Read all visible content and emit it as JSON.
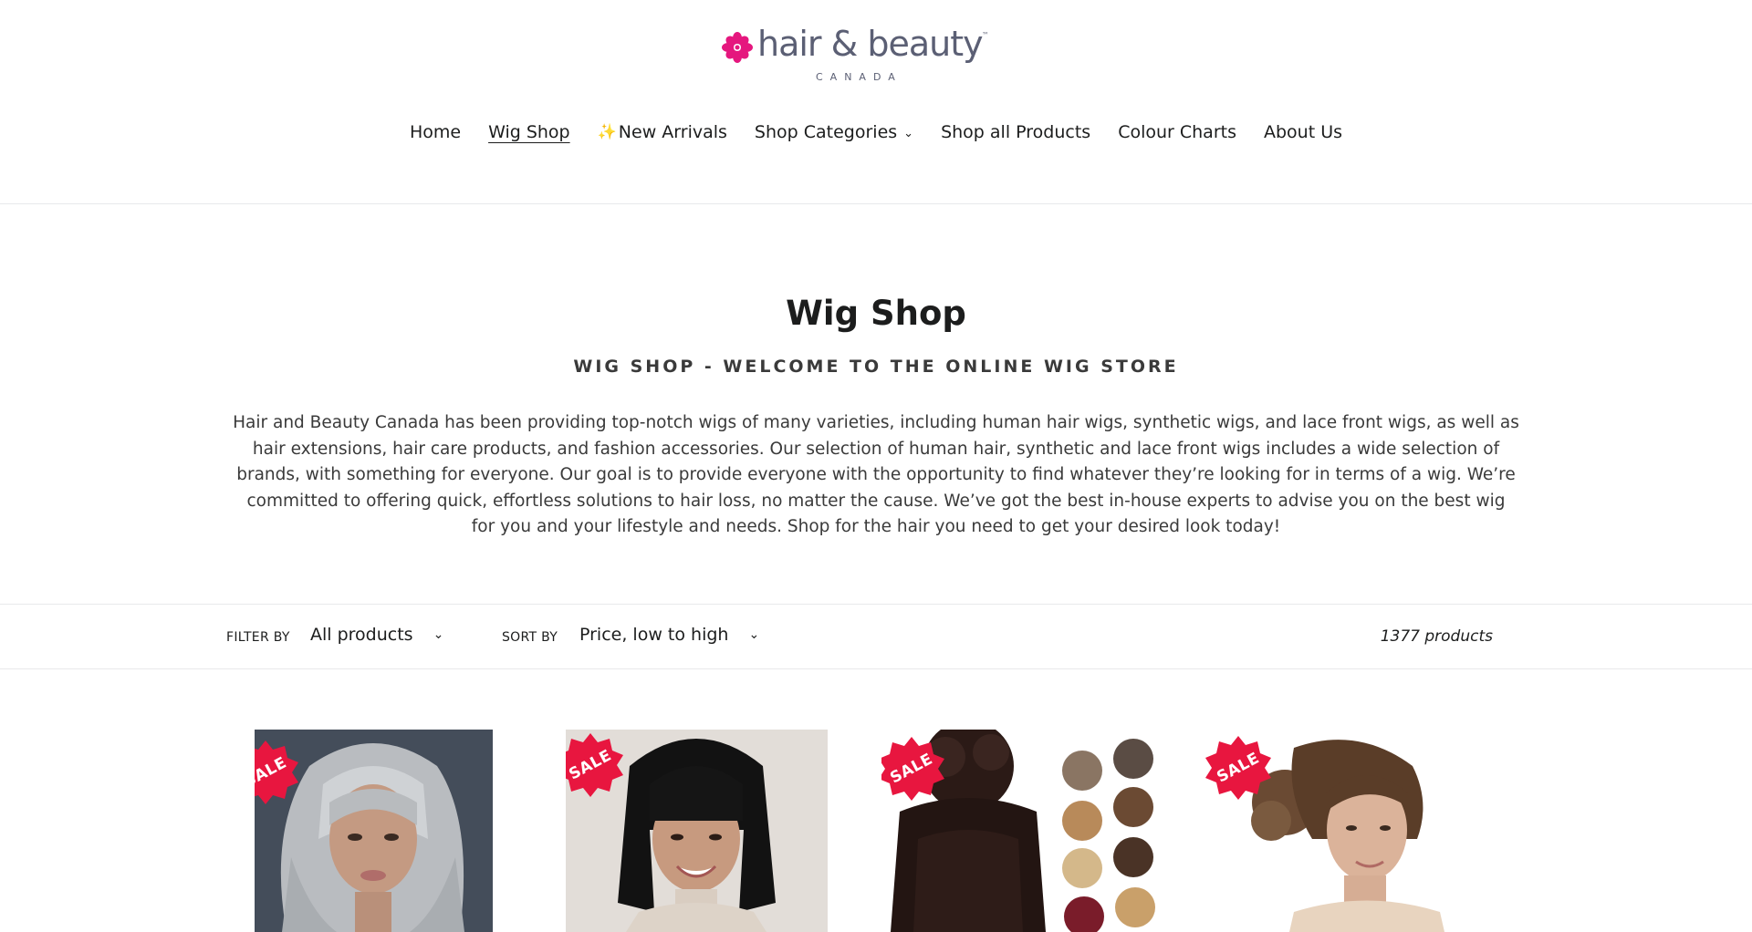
{
  "brand": {
    "name": "hair & beauty",
    "tm": "™",
    "sub": "CANADA",
    "flower_color": "#e5177e",
    "text_color": "#5b5f74"
  },
  "nav": {
    "items": [
      {
        "label": "Home"
      },
      {
        "label": "Wig Shop",
        "active": true
      },
      {
        "label": "New Arrivals",
        "icon": "sparkles-icon",
        "prefix": "✨"
      },
      {
        "label": "Shop Categories",
        "has_dropdown": true
      },
      {
        "label": "Shop all Products"
      },
      {
        "label": "Colour Charts"
      },
      {
        "label": "About Us"
      }
    ]
  },
  "collection": {
    "title": "Wig Shop",
    "subtitle": "WIG SHOP - WELCOME TO THE ONLINE WIG STORE",
    "description": "Hair and Beauty Canada has been providing top-notch wigs of many varieties, including human hair wigs, synthetic wigs, and lace front wigs, as well as hair extensions, hair care products, and fashion accessories. Our selection of human hair, synthetic and lace front wigs includes a wide selection of brands, with something for everyone. Our goal is to provide everyone with the opportunity to find whatever they’re looking for in terms of a wig. We’re committed to offering quick, effortless solutions to hair loss, no matter the cause. We’ve got the best in-house experts to advise you on the best wig for you and your lifestyle and needs. Shop for the hair you need to get your desired look today!"
  },
  "filters": {
    "filter_label": "FILTER BY",
    "filter_value": "All products",
    "sort_label": "SORT BY",
    "sort_value": "Price, low to high",
    "product_count": "1377 products"
  },
  "products": [
    {
      "badge": "SALE",
      "image": "silver-wavy-wig-photo"
    },
    {
      "badge": "SALE",
      "image": "black-bob-bangs-wig-photo"
    },
    {
      "badge": "SALE",
      "image": "messy-bun-scrunchie-photo"
    },
    {
      "badge": "SALE",
      "image": "updo-clip-in-bun-photo"
    }
  ],
  "colors": {
    "sale_badge": "#e8163f",
    "text": "#1c1d1d",
    "border": "#e8e9eb"
  }
}
